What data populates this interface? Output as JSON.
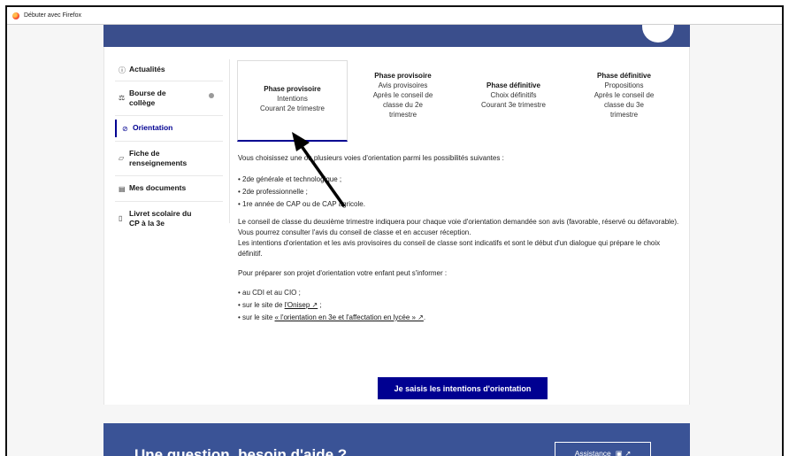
{
  "browser": {
    "tab_title": "Débuter avec Firefox"
  },
  "sidebar": {
    "items": [
      {
        "icon": "ⓘ",
        "label": "Actualités"
      },
      {
        "icon": "⚖",
        "label": "Bourse de collège"
      },
      {
        "icon": "⊘",
        "label": "Orientation"
      },
      {
        "icon": "▱",
        "label": "Fiche de renseignements"
      },
      {
        "icon": "▤",
        "label": "Mes documents"
      },
      {
        "icon": "▯",
        "label": "Livret scolaire du CP à la 3e"
      }
    ]
  },
  "phases": [
    {
      "title": "Phase provisoire",
      "l1": "Intentions",
      "l2": "Courant 2e trimestre",
      "l3": "",
      "l4": ""
    },
    {
      "title": "Phase provisoire",
      "l1": "Avis provisoires",
      "l2": "Après le conseil de",
      "l3": "classe du 2e",
      "l4": "trimestre"
    },
    {
      "title": "Phase définitive",
      "l1": "Choix définitifs",
      "l2": "Courant 3e trimestre",
      "l3": "",
      "l4": ""
    },
    {
      "title": "Phase définitive",
      "l1": "Propositions",
      "l2": "Après le conseil de",
      "l3": "classe du 3e",
      "l4": "trimestre"
    }
  ],
  "content": {
    "intro": "Vous choisissez une ou plusieurs voies d'orientation parmi les possibilités suivantes :",
    "options": [
      "2de générale et technologique ;",
      "2de professionnelle ;",
      "1re année de CAP ou de CAP agricole."
    ],
    "para1": "Le conseil de classe du deuxième trimestre indiquera pour chaque voie d'orientation demandée son avis (favorable, réservé ou défavorable).",
    "para2": "Vous pourrez consulter l'avis du conseil de classe et en accuser réception.",
    "para3": "Les intentions d'orientation et les avis provisoires du conseil de classe sont indicatifs et sont le début d'un dialogue qui prépare le choix définitif.",
    "info_intro": "Pour préparer son projet d'orientation votre enfant peut s'informer :",
    "info1": "au CDI et au CIO ;",
    "info2_prefix": "sur le site de ",
    "info2_link": "l'Onisep ↗",
    "info2_suffix": " ;",
    "info3_prefix": "sur le site ",
    "info3_link": "« l'orientation en 3e et l'affectation en lycée » ↗",
    "info3_suffix": "."
  },
  "cta_label": "Je saisis les intentions d'orientation",
  "help": {
    "title": "Une question, besoin d'aide ?",
    "assist_label": "Assistance",
    "assist_icon": "▣ ↗"
  },
  "colors": {
    "primary": "#000091",
    "banner": "#3a5396"
  }
}
